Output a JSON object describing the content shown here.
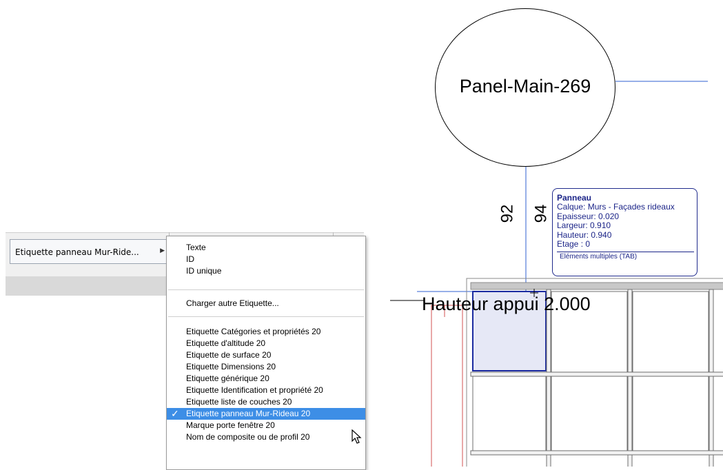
{
  "toolbar": {
    "dropdown_label": "Etiquette panneau Mur-Ride...",
    "dropdown_arrow": "▶"
  },
  "context_menu": {
    "group1": [
      "Texte",
      "ID",
      "ID unique"
    ],
    "group2": [
      "Charger autre Etiquette..."
    ],
    "group3": [
      "Etiquette Catégories et propriétés 20",
      "Etiquette d'altitude 20",
      "Etiquette de surface 20",
      "Etiquette Dimensions 20",
      "Etiquette générique 20",
      "Etiquette Identification et propriété 20",
      "Etiquette liste de couches 20",
      "Etiquette panneau Mur-Rideau 20",
      "Marque porte fenêtre 20",
      "Nom de composite ou de profil 20"
    ],
    "selected_item": "Etiquette panneau Mur-Rideau 20",
    "checkmark": "✓",
    "selection_color": "#3d8ee6"
  },
  "drawing": {
    "panel_label": "Panel-Main-269",
    "dim_a": "92",
    "dim_b": "94",
    "hauteur_text": "Hauteur appui  2.000",
    "tooltip": {
      "title": "Panneau",
      "lines": [
        "Calque:  Murs - Façades rideaux",
        "Epaisseur: 0.020",
        "Largeur: 0.910",
        "Hauteur: 0.940",
        "Etage : 0"
      ],
      "footer": "Eléments multiples (TAB)"
    },
    "line_color": "#2f5fd0",
    "highlight_fill": "#e6e8f6"
  }
}
